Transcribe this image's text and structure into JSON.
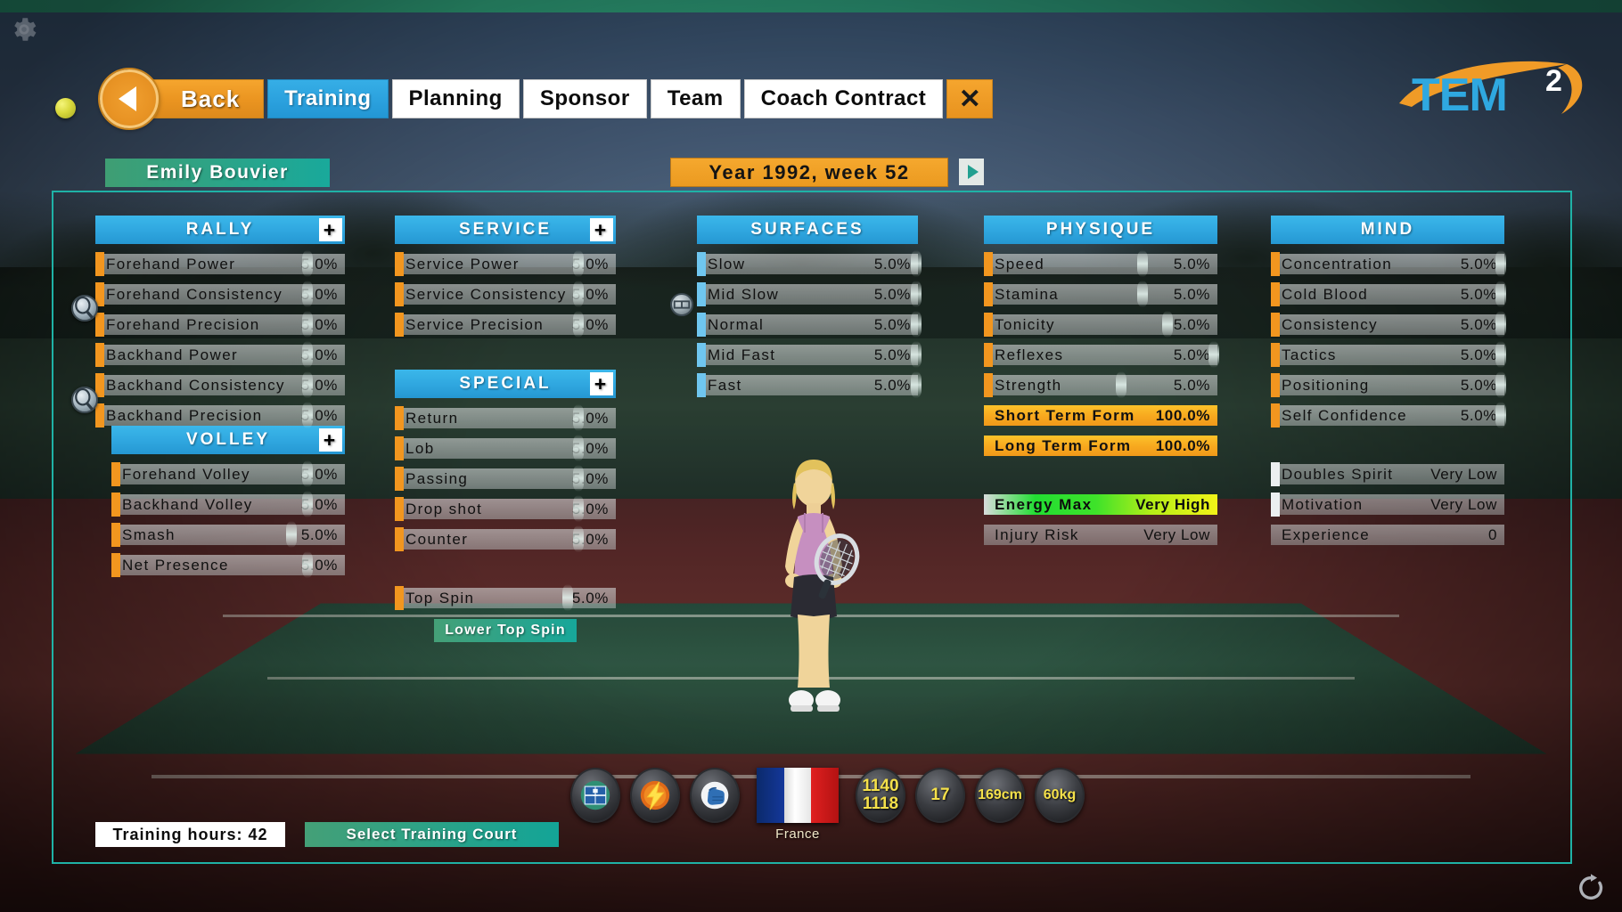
{
  "app": {
    "logo_text": "TEM",
    "logo_sup": "2"
  },
  "topbar": {
    "back_label": "Back",
    "close_label": "✕",
    "tabs": [
      {
        "label": "Training",
        "active": true
      },
      {
        "label": "Planning",
        "active": false
      },
      {
        "label": "Sponsor",
        "active": false
      },
      {
        "label": "Team",
        "active": false
      },
      {
        "label": "Coach Contract",
        "active": false
      }
    ]
  },
  "header": {
    "player_name": "Emily  Bouvier",
    "week_label": "Year 1992, week 52",
    "next_week_icon": "play-triangle-icon"
  },
  "columns": {
    "rally": {
      "title": "RALLY",
      "plus": "+",
      "rows": [
        {
          "label": "Forehand Power",
          "value": "5.0%"
        },
        {
          "label": "Forehand Consistency",
          "value": "5.0%"
        },
        {
          "label": "Forehand Precision",
          "value": "5.0%"
        },
        {
          "label": "Backhand Power",
          "value": "5.0%"
        },
        {
          "label": "Backhand Consistency",
          "value": "5.0%"
        },
        {
          "label": "Backhand Precision",
          "value": "5.0%"
        }
      ]
    },
    "volley": {
      "title": "VOLLEY",
      "plus": "+",
      "rows": [
        {
          "label": "Forehand Volley",
          "value": "5.0%"
        },
        {
          "label": "Backhand Volley",
          "value": "5.0%"
        },
        {
          "label": "Smash",
          "value": "5.0%"
        },
        {
          "label": "Net Presence",
          "value": "5.0%"
        }
      ]
    },
    "service": {
      "title": "SERVICE",
      "plus": "+",
      "rows": [
        {
          "label": "Service Power",
          "value": "5.0%"
        },
        {
          "label": "Service Consistency",
          "value": "5.0%"
        },
        {
          "label": "Service Precision",
          "value": "5.0%"
        }
      ]
    },
    "special": {
      "title": "SPECIAL",
      "plus": "+",
      "rows": [
        {
          "label": "Return",
          "value": "5.0%"
        },
        {
          "label": "Lob",
          "value": "5.0%"
        },
        {
          "label": "Passing",
          "value": "5.0%"
        },
        {
          "label": "Drop shot",
          "value": "5.0%"
        },
        {
          "label": "Counter",
          "value": "5.0%"
        }
      ],
      "topspin": {
        "label": "Top Spin",
        "value": "5.0%"
      },
      "lower_topspin_label": "Lower Top Spin"
    },
    "surfaces": {
      "title": "SURFACES",
      "rows": [
        {
          "label": "Slow",
          "value": "5.0%"
        },
        {
          "label": "Mid Slow",
          "value": "5.0%"
        },
        {
          "label": "Normal",
          "value": "5.0%"
        },
        {
          "label": "Mid Fast",
          "value": "5.0%"
        },
        {
          "label": "Fast",
          "value": "5.0%"
        }
      ]
    },
    "physique": {
      "title": "PHYSIQUE",
      "rows": [
        {
          "label": "Speed",
          "value": "5.0%"
        },
        {
          "label": "Stamina",
          "value": "5.0%"
        },
        {
          "label": "Tonicity",
          "value": "5.0%"
        },
        {
          "label": "Reflexes",
          "value": "5.0%"
        },
        {
          "label": "Strength",
          "value": "5.0%"
        }
      ],
      "form_rows": [
        {
          "label": "Short Term Form",
          "value": "100.0%"
        },
        {
          "label": "Long Term Form",
          "value": "100.0%"
        }
      ],
      "energy": {
        "label": "Energy Max",
        "value": "Very High"
      },
      "injury": {
        "label": "Injury Risk",
        "value": "Very Low"
      }
    },
    "mind": {
      "title": "MIND",
      "rows": [
        {
          "label": "Concentration",
          "value": "5.0%"
        },
        {
          "label": "Cold Blood",
          "value": "5.0%"
        },
        {
          "label": "Consistency",
          "value": "5.0%"
        },
        {
          "label": "Tactics",
          "value": "5.0%"
        },
        {
          "label": "Positioning",
          "value": "5.0%"
        },
        {
          "label": "Self Confidence",
          "value": "5.0%"
        }
      ],
      "extra_rows": [
        {
          "label": "Doubles Spirit",
          "value": "Very Low"
        },
        {
          "label": "Motivation",
          "value": "Very Low"
        },
        {
          "label": "Experience",
          "value": "0"
        }
      ]
    }
  },
  "player_icons": {
    "playstyle_icon": "tennis-court-icon",
    "speed_icon": "lightning-bolt-icon",
    "power_icon": "fist-icon",
    "country": "France",
    "country_flag_icon": "france-flag-icon",
    "rank_single": "1140",
    "rank_double": "1118",
    "age": "17",
    "height": "169cm",
    "weight": "60kg"
  },
  "bottom": {
    "training_hours": "Training hours: 42",
    "select_court_label": "Select Training Court"
  }
}
